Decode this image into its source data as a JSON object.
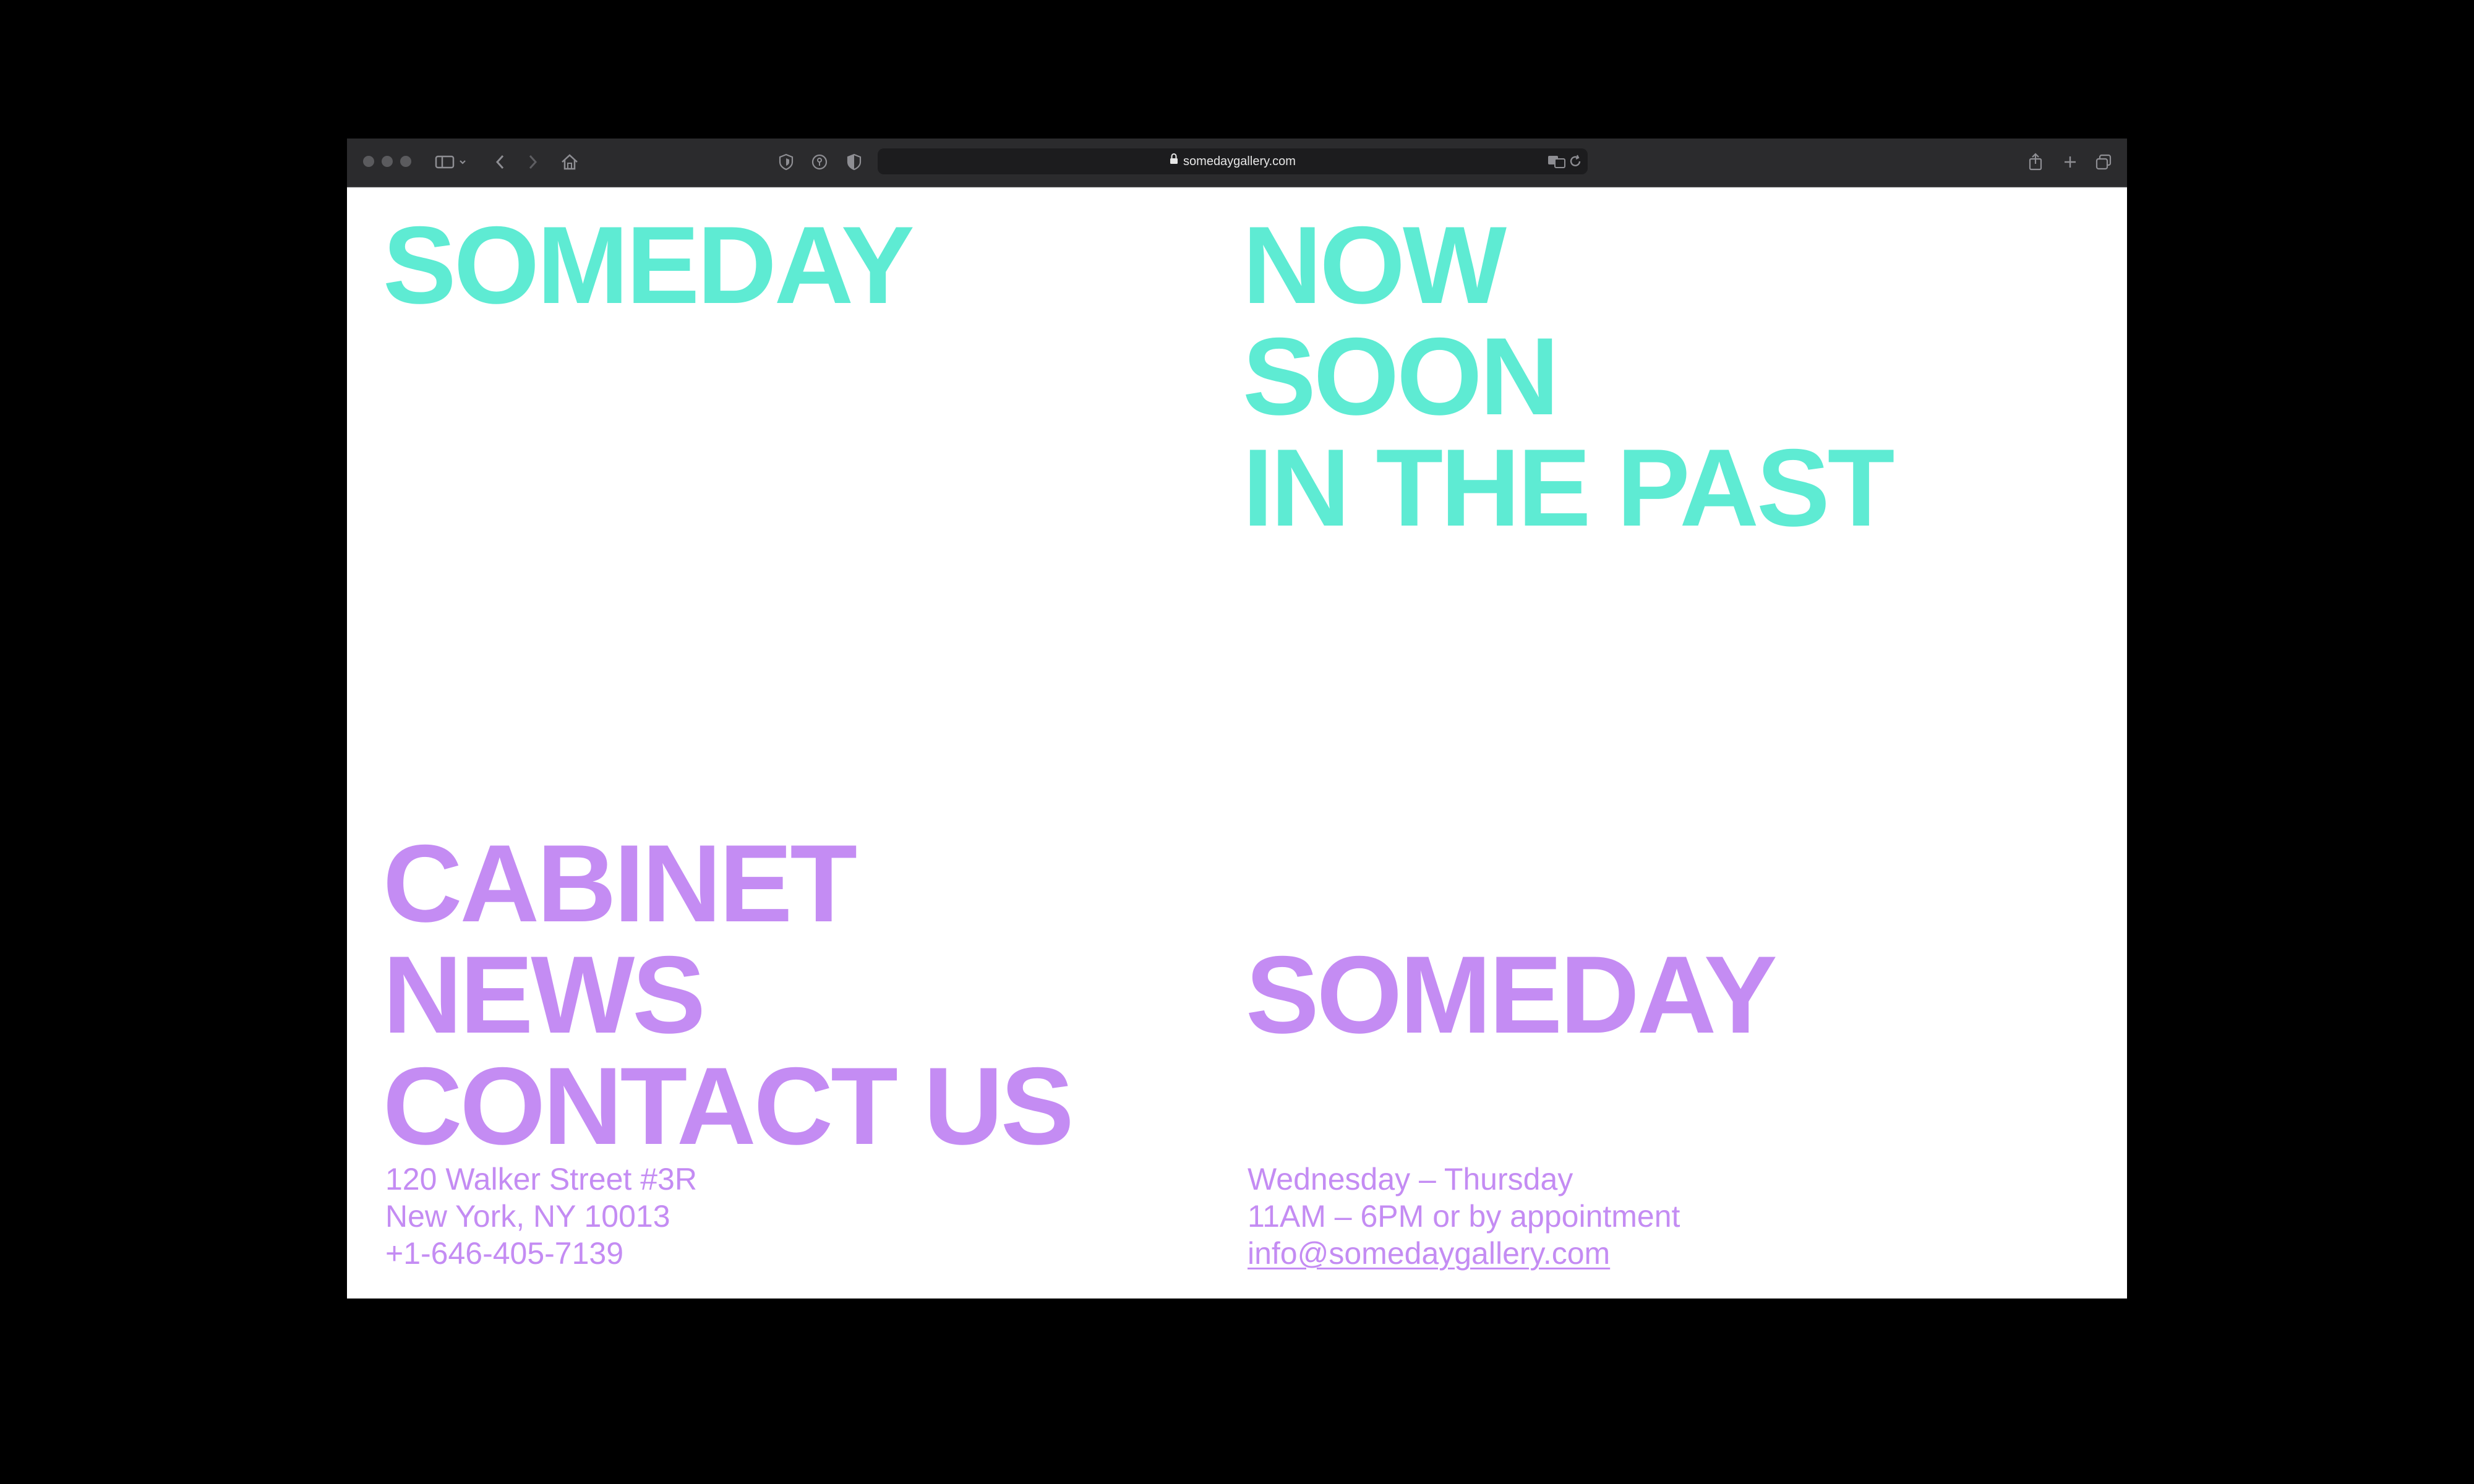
{
  "browser": {
    "url": "somedaygallery.com"
  },
  "header": {
    "logo": "SOMEDAY"
  },
  "primary_nav": {
    "items": [
      {
        "label": "NOW"
      },
      {
        "label": "SOON"
      },
      {
        "label": "IN THE PAST"
      }
    ]
  },
  "secondary_nav": {
    "items": [
      {
        "label": "CABINET"
      },
      {
        "label": "NEWS"
      },
      {
        "label": "CONTACT US"
      }
    ]
  },
  "footer": {
    "logo": "SOMEDAY",
    "address": {
      "line1": "120 Walker Street #3R",
      "line2": "New York, NY 10013",
      "phone": "+1-646-405-7139"
    },
    "hours": {
      "days": "Wednesday – Thursday",
      "times": "11AM – 6PM or by appointment",
      "email": "info@somedaygallery.com"
    }
  },
  "colors": {
    "teal": "#5eebd3",
    "purple": "#c48cf3",
    "toolbar": "#2b2b2d",
    "background": "#000000"
  }
}
